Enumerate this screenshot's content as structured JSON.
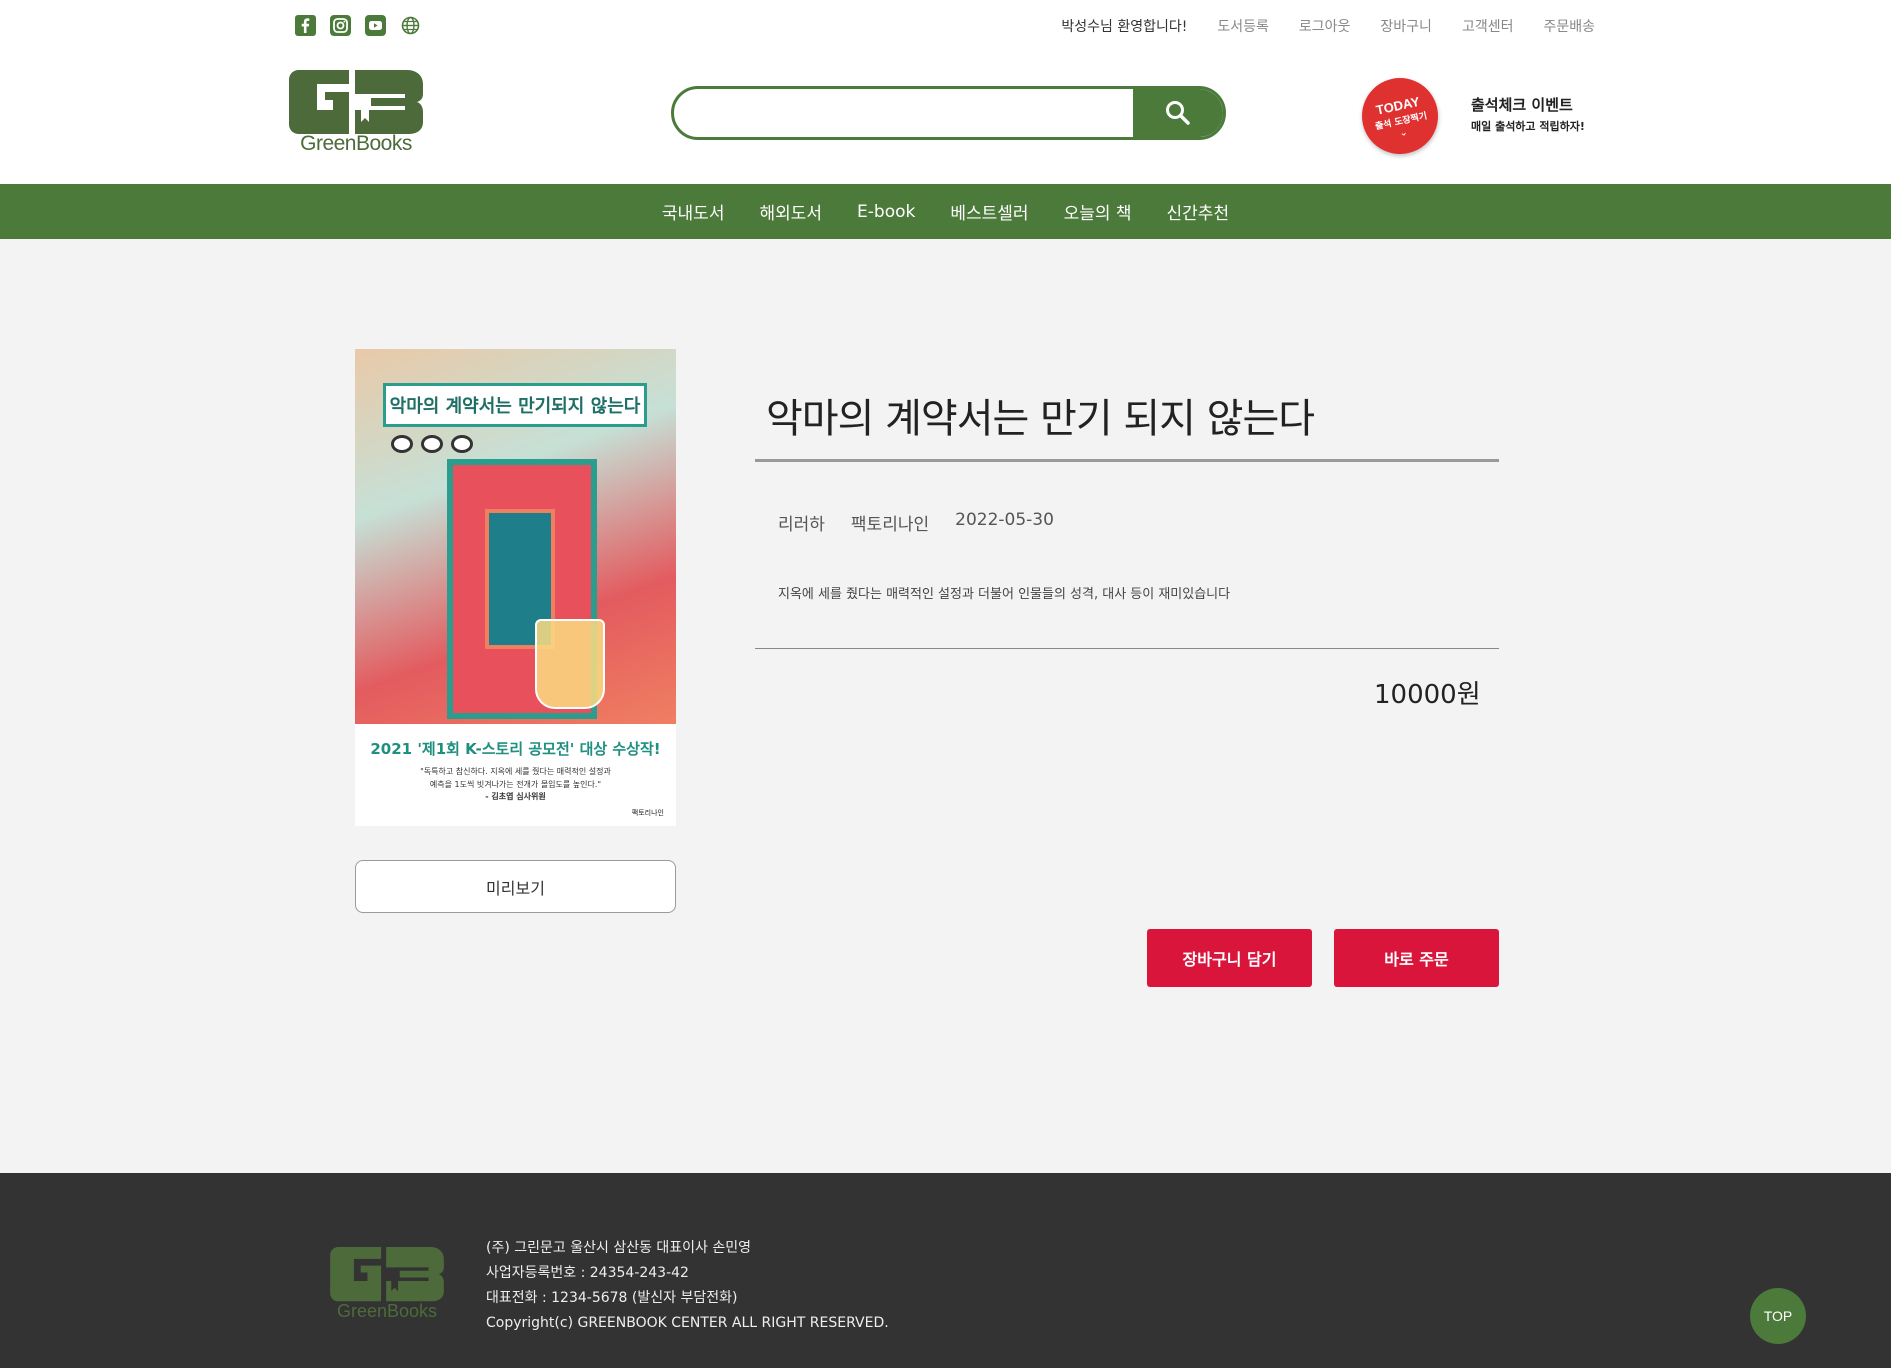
{
  "header": {
    "utility_links": {
      "welcome": "박성수님 환영합니다!",
      "register_book": "도서등록",
      "logout": "로그아웃",
      "cart": "장바구니",
      "support": "고객센터",
      "order_delivery": "주문배송"
    },
    "logo_text": "GreenBooks",
    "search": {
      "value": "",
      "placeholder": ""
    },
    "event": {
      "badge_top": "TODAY",
      "badge_sub": "출석 도장찍기",
      "title": "출석체크 이벤트",
      "subtitle": "매일 출석하고 적립하자!"
    }
  },
  "nav": {
    "items": [
      "국내도서",
      "해외도서",
      "E-book",
      "베스트셀러",
      "오늘의 책",
      "신간추천"
    ]
  },
  "book": {
    "cover": {
      "title": "악마의 계약서는 만기되지 않는다",
      "award": "2021 '제1회 K-스토리 공모전' 대상 수상작!",
      "quote_line1": "\"독특하고 참신하다. 지옥에 세를 줬다는 매력적인 설정과",
      "quote_line2": "예측을 1도씩 빗겨나가는 전개가 몰입도를 높인다.\"",
      "quote_author": "- 김초엽 심사위원",
      "publisher_mark": "팩토리나인"
    },
    "title": "악마의 계약서는 만기 되지 않는다",
    "author": "리러하",
    "publisher": "팩토리나인",
    "date": "2022-05-30",
    "description": "지옥에 세를 줬다는 매력적인 설정과 더불어 인물들의 성격, 대사 등이 재미있습니다",
    "price": "10000원",
    "preview_label": "미리보기",
    "cart_label": "장바구니 담기",
    "order_label": "바로 주문"
  },
  "footer": {
    "logo_text": "GreenBooks",
    "line1": "(주) 그린문고 울산시 삼산동 대표이사 손민영",
    "line2": "사업자등록번호 : 24354-243-42",
    "line3": "대표전화 : 1234-5678 (발신자 부담전화)",
    "line4": "Copyright(c) GREENBOOK CENTER ALL RIGHT RESERVED.",
    "top_label": "TOP"
  },
  "colors": {
    "brand_green": "#4c7a3b",
    "cta_red": "#d9153b",
    "footer_bg": "#333333",
    "page_bg": "#f3f3f3"
  },
  "icons": [
    "facebook-icon",
    "instagram-icon",
    "youtube-icon",
    "globe-icon",
    "search-icon"
  ]
}
